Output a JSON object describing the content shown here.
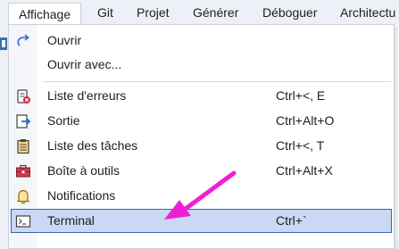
{
  "menubar": {
    "items": [
      {
        "label": "Affichage"
      },
      {
        "label": "Git"
      },
      {
        "label": "Projet"
      },
      {
        "label": "Générer"
      },
      {
        "label": "Déboguer"
      },
      {
        "label": "Architectu"
      }
    ]
  },
  "dropdown": {
    "items": [
      {
        "label": "Ouvrir",
        "shortcut": "",
        "icon": "open-arrow-icon"
      },
      {
        "label": "Ouvrir avec...",
        "shortcut": "",
        "icon": ""
      },
      {
        "label": "Liste d'erreurs",
        "shortcut": "Ctrl+<, E",
        "icon": "error-list-icon"
      },
      {
        "label": "Sortie",
        "shortcut": "Ctrl+Alt+O",
        "icon": "output-icon"
      },
      {
        "label": "Liste des tâches",
        "shortcut": "Ctrl+<, T",
        "icon": "task-list-icon"
      },
      {
        "label": "Boîte à outils",
        "shortcut": "Ctrl+Alt+X",
        "icon": "toolbox-icon"
      },
      {
        "label": "Notifications",
        "shortcut": "",
        "icon": "bell-icon"
      },
      {
        "label": "Terminal",
        "shortcut": "Ctrl+`",
        "icon": "terminal-icon"
      }
    ],
    "selected": "Terminal"
  },
  "colors": {
    "menubar_bg": "#eef0f7",
    "selection_bg": "#c9d8f5",
    "selection_border": "#3d63a8",
    "annotation_arrow": "#f01fd6"
  }
}
